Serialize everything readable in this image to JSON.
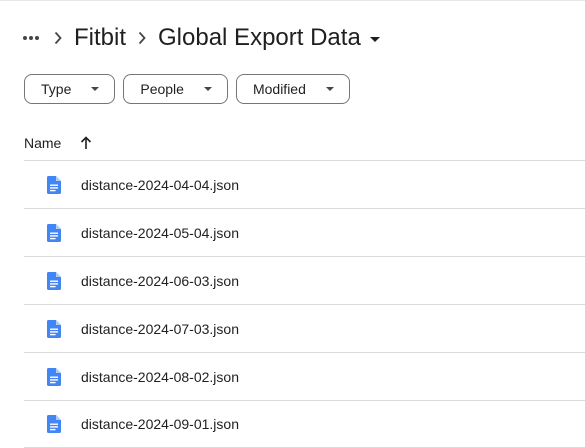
{
  "breadcrumb": {
    "more_icon": "more-horiz-icon",
    "separator_icon": "chevron-right-icon",
    "parent": "Fitbit",
    "current": "Global Export Data",
    "current_dropdown_icon": "caret-down-icon"
  },
  "filters": [
    {
      "label": "Type"
    },
    {
      "label": "People"
    },
    {
      "label": "Modified"
    }
  ],
  "list_header": {
    "name_label": "Name",
    "sort_icon": "arrow-up-icon"
  },
  "files": [
    {
      "name": "distance-2024-04-04.json",
      "icon": "document-icon"
    },
    {
      "name": "distance-2024-05-04.json",
      "icon": "document-icon"
    },
    {
      "name": "distance-2024-06-03.json",
      "icon": "document-icon"
    },
    {
      "name": "distance-2024-07-03.json",
      "icon": "document-icon"
    },
    {
      "name": "distance-2024-08-02.json",
      "icon": "document-icon"
    },
    {
      "name": "distance-2024-09-01.json",
      "icon": "document-icon"
    }
  ],
  "colors": {
    "doc_icon_blue": "#4285f4",
    "text": "#1f1f1f",
    "chip_border": "#747775",
    "divider": "#dadce0"
  }
}
